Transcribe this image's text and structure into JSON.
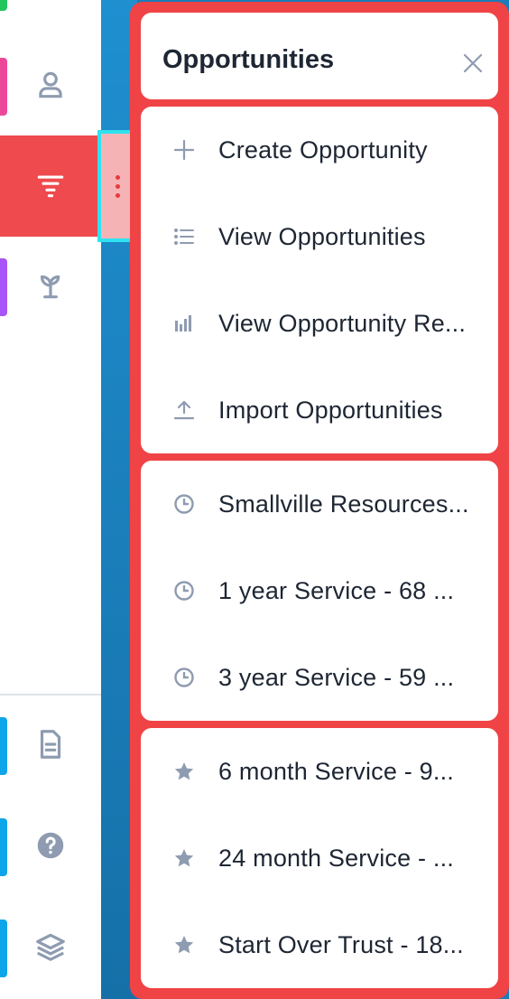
{
  "panel": {
    "title": "Opportunities",
    "actions": [
      {
        "label": "Create Opportunity",
        "icon": "plus-icon"
      },
      {
        "label": "View Opportunities",
        "icon": "list-icon"
      },
      {
        "label": "View Opportunity Re...",
        "icon": "bar-chart-icon"
      },
      {
        "label": "Import Opportunities",
        "icon": "upload-icon"
      }
    ],
    "recent": [
      {
        "label": "Smallville Resources...",
        "icon": "clock-icon"
      },
      {
        "label": "1 year Service - 68 ...",
        "icon": "clock-icon"
      },
      {
        "label": "3 year Service - 59 ...",
        "icon": "clock-icon"
      }
    ],
    "favorites": [
      {
        "label": "6 month Service - 9...",
        "icon": "star-icon"
      },
      {
        "label": "24 month Service - ...",
        "icon": "star-icon"
      },
      {
        "label": "Start Over Trust - 18...",
        "icon": "star-icon"
      }
    ]
  },
  "sidebar": {
    "items": [
      {
        "name": "contacts",
        "icon": "user-icon",
        "accent": "#ec4899"
      },
      {
        "name": "opportunities",
        "icon": "funnel-icon",
        "active": true
      },
      {
        "name": "leads",
        "icon": "sprout-icon",
        "accent": "#a855f7"
      },
      {
        "name": "documents",
        "icon": "document-icon",
        "accent": "#0ea5e9"
      },
      {
        "name": "help",
        "icon": "help-icon",
        "accent": "#0ea5e9"
      },
      {
        "name": "layers",
        "icon": "layers-icon",
        "accent": "#0ea5e9"
      }
    ]
  },
  "colors": {
    "panel_bg": "#ef4346",
    "icon_gray": "#8e9bb0",
    "text_dark": "#1e2633",
    "stripe_blue": "#1a7cb8"
  }
}
